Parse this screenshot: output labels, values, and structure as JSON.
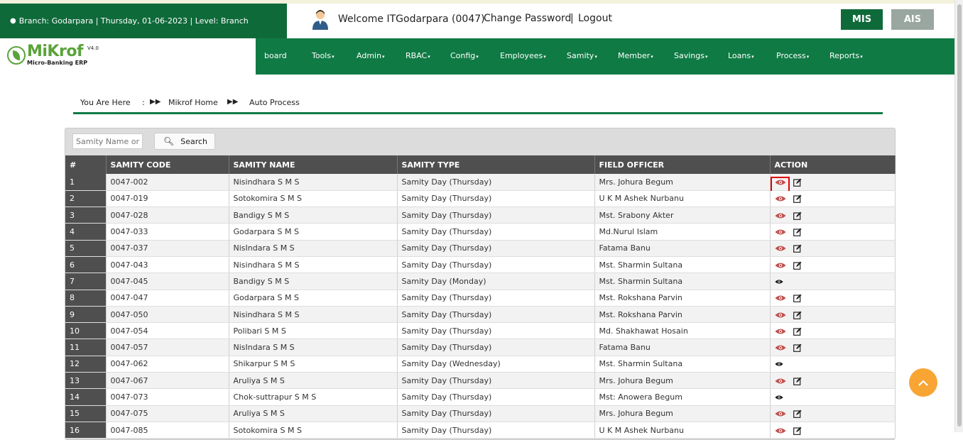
{
  "header": {
    "branch_info": "Branch: Godarpara | Thursday, 01-06-2023 | Level: Branch",
    "welcome": "Welcome ITGodarpara (0047)",
    "change_password": "Change Password",
    "separator": "|",
    "logout": "Logout",
    "mis_label": "MIS",
    "ais_label": "AIS"
  },
  "logo": {
    "name": "MiKrof",
    "version": "V4.0",
    "subtitle": "Micro-Banking ERP"
  },
  "nav": {
    "items": [
      {
        "label": "board",
        "dropdown": false
      },
      {
        "label": "Tools",
        "dropdown": true
      },
      {
        "label": "Admin",
        "dropdown": true
      },
      {
        "label": "RBAC",
        "dropdown": true
      },
      {
        "label": "Config",
        "dropdown": true
      },
      {
        "label": "Employees",
        "dropdown": true
      },
      {
        "label": "Samity",
        "dropdown": true
      },
      {
        "label": "Member",
        "dropdown": true
      },
      {
        "label": "Savings",
        "dropdown": true
      },
      {
        "label": "Loans",
        "dropdown": true
      },
      {
        "label": "Process",
        "dropdown": true
      },
      {
        "label": "Reports",
        "dropdown": true
      }
    ]
  },
  "breadcrumb": {
    "prefix": "You Are Here",
    "colon": ":",
    "home": "Mikrof Home",
    "current": "Auto Process"
  },
  "search": {
    "placeholder": "Samity Name or",
    "button_label": "Search"
  },
  "table": {
    "headers": [
      "#",
      "SAMITY CODE",
      "SAMITY NAME",
      "SAMITY TYPE",
      "FIELD OFFICER",
      "ACTION"
    ],
    "rows": [
      {
        "n": "1",
        "code": "0047-002",
        "name": "Nisindhara S M S",
        "type": "Samity Day (Thursday)",
        "officer": "Mrs. Johura Begum",
        "editable": true,
        "highlighted": true
      },
      {
        "n": "2",
        "code": "0047-019",
        "name": "Sotokomira S M S",
        "type": "Samity Day (Thursday)",
        "officer": "U K M Ashek Nurbanu",
        "editable": true
      },
      {
        "n": "3",
        "code": "0047-028",
        "name": "Bandigy S M S",
        "type": "Samity Day (Thursday)",
        "officer": "Mst. Srabony Akter",
        "editable": true
      },
      {
        "n": "4",
        "code": "0047-033",
        "name": "Godarpara S M S",
        "type": "Samity Day (Thursday)",
        "officer": "Md.Nurul Islam",
        "editable": true
      },
      {
        "n": "5",
        "code": "0047-037",
        "name": "NisIndara S M S",
        "type": "Samity Day (Thursday)",
        "officer": "Fatama Banu",
        "editable": true
      },
      {
        "n": "6",
        "code": "0047-043",
        "name": "Nisindhara S M S",
        "type": "Samity Day (Thursday)",
        "officer": "Mst. Sharmin Sultana",
        "editable": true
      },
      {
        "n": "7",
        "code": "0047-045",
        "name": "Bandigy S M S",
        "type": "Samity Day (Monday)",
        "officer": "Mst. Sharmin Sultana",
        "editable": false
      },
      {
        "n": "8",
        "code": "0047-047",
        "name": "Godarpara S M S",
        "type": "Samity Day (Thursday)",
        "officer": "Mst. Rokshana Parvin",
        "editable": true
      },
      {
        "n": "9",
        "code": "0047-050",
        "name": "Nisindhara S M S",
        "type": "Samity Day (Thursday)",
        "officer": "Mst. Rokshana Parvin",
        "editable": true
      },
      {
        "n": "10",
        "code": "0047-054",
        "name": "Polibari S M S",
        "type": "Samity Day (Thursday)",
        "officer": "Md. Shakhawat Hosain",
        "editable": true
      },
      {
        "n": "11",
        "code": "0047-057",
        "name": "NisIndara S M S",
        "type": "Samity Day (Thursday)",
        "officer": "Fatama Banu",
        "editable": true
      },
      {
        "n": "12",
        "code": "0047-062",
        "name": "Shikarpur S M S",
        "type": "Samity Day (Wednesday)",
        "officer": "Mst. Sharmin Sultana",
        "editable": false
      },
      {
        "n": "13",
        "code": "0047-067",
        "name": "Aruliya S M S",
        "type": "Samity Day (Thursday)",
        "officer": "Mrs. Johura Begum",
        "editable": true
      },
      {
        "n": "14",
        "code": "0047-073",
        "name": "Chok-suttrapur S M S",
        "type": "Samity Day (Thursday)",
        "officer": "Mst: Anowera Begum",
        "editable": false
      },
      {
        "n": "15",
        "code": "0047-075",
        "name": "Aruliya S M S",
        "type": "Samity Day (Thursday)",
        "officer": "Mrs. Johura Begum",
        "editable": true
      },
      {
        "n": "16",
        "code": "0047-085",
        "name": "Sotokomira S M S",
        "type": "Samity Day (Thursday)",
        "officer": "U K M Ashek Nurbanu",
        "editable": true
      }
    ]
  },
  "colors": {
    "brand_dark": "#0f6a3a",
    "brand": "#0f7a44",
    "logo_green": "#5aa33a",
    "table_header": "#4f4f4f",
    "eye_active": "#c0504d",
    "highlight": "#e00000",
    "fab": "#f8a534"
  },
  "icons": {
    "branch": "globe-icon",
    "user": "user-avatar-icon",
    "search": "search-icon",
    "view": "eye-icon",
    "edit": "edit-icon",
    "scroll_top": "chevron-up-icon"
  }
}
